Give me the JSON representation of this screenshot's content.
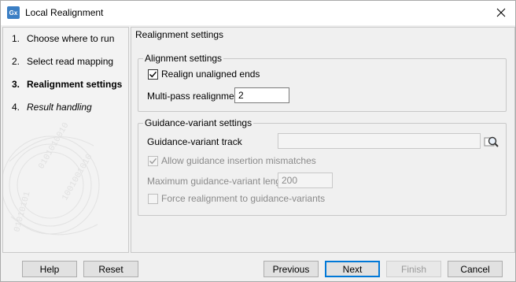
{
  "window": {
    "title": "Local Realignment",
    "icon_label": "Gx",
    "icon": "close-icon"
  },
  "steps": [
    {
      "num": "1.",
      "label": "Choose where to run"
    },
    {
      "num": "2.",
      "label": "Select read mapping"
    },
    {
      "num": "3.",
      "label": "Realignment settings"
    },
    {
      "num": "4.",
      "label": "Result handling"
    }
  ],
  "page": {
    "title": "Realignment settings",
    "alignment": {
      "legend": "Alignment settings",
      "realign_label": "Realign unaligned ends",
      "realign_checked": true,
      "multipass_label": "Multi-pass realignment",
      "multipass_value": "2"
    },
    "guidance": {
      "legend": "Guidance-variant settings",
      "track_label": "Guidance-variant track",
      "track_value": "",
      "allow_label": "Allow guidance insertion mismatches",
      "allow_checked": true,
      "maxlen_label": "Maximum guidance-variant length",
      "maxlen_value": "200",
      "force_label": "Force realignment to guidance-variants",
      "force_checked": false
    }
  },
  "buttons": {
    "help": "Help",
    "reset": "Reset",
    "previous": "Previous",
    "next": "Next",
    "finish": "Finish",
    "cancel": "Cancel"
  }
}
